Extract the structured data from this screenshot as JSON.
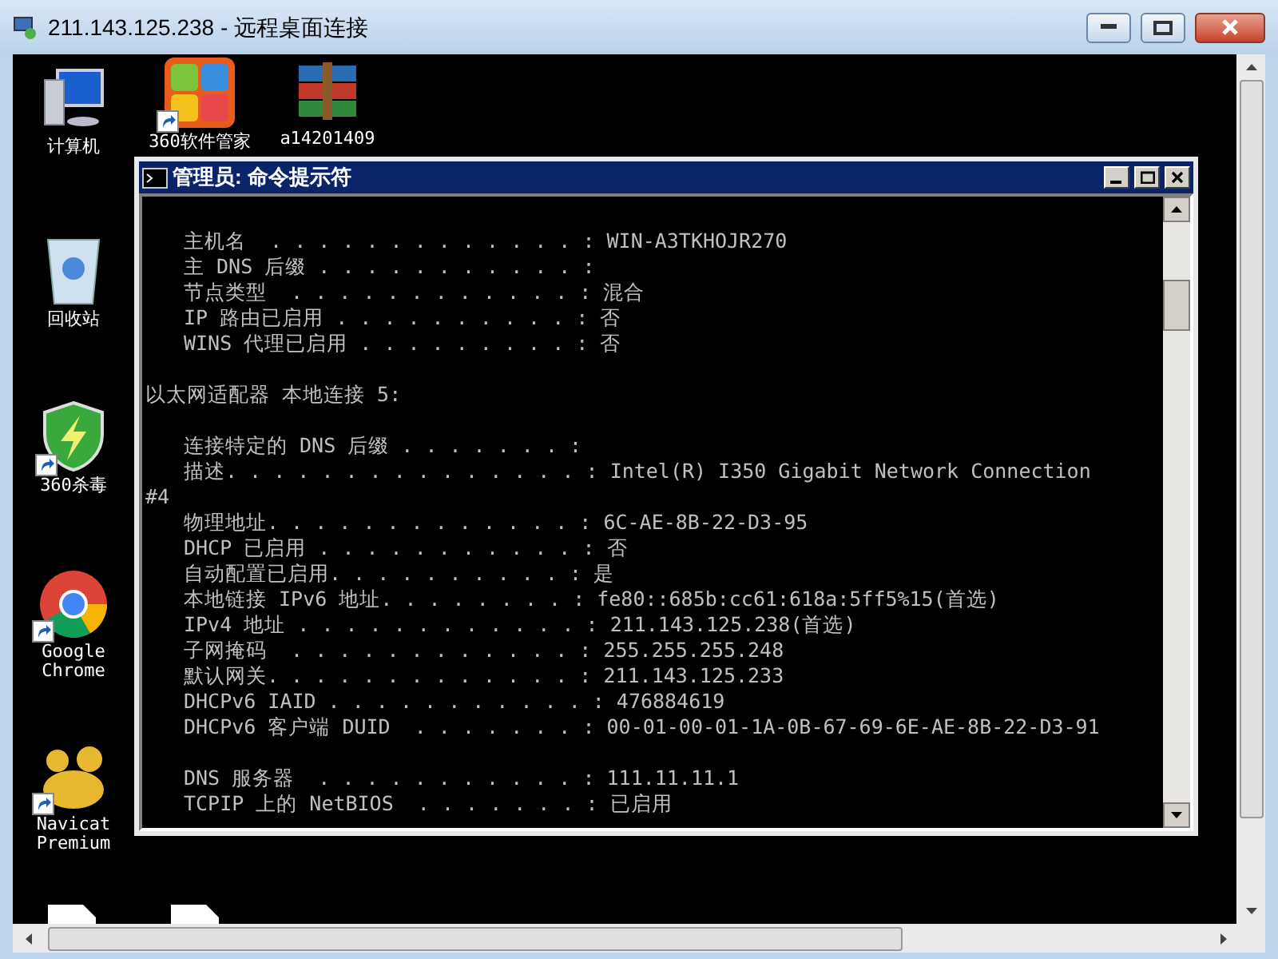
{
  "window": {
    "title": "211.143.125.238 - 远程桌面连接"
  },
  "desktop_icons": [
    {
      "kind": "computer",
      "label": "计算机",
      "shortcut": false
    },
    {
      "kind": "software-manager",
      "label": "360软件管家",
      "shortcut": true
    },
    {
      "kind": "archive",
      "label": "a14201409",
      "shortcut": false
    },
    {
      "kind": "recycle-bin",
      "label": "回收站",
      "shortcut": false
    },
    {
      "kind": "shield",
      "label": "360杀毒",
      "shortcut": true
    },
    {
      "kind": "browser",
      "label": "Google Chrome",
      "shortcut": true
    },
    {
      "kind": "database",
      "label": "Navicat Premium",
      "shortcut": true
    }
  ],
  "console": {
    "title": "管理员: 命令提示符",
    "lines": [
      {
        "kind": "entry",
        "text": "主机名  . . . . . . . . . . . . . : WIN-A3TKHOJR270"
      },
      {
        "kind": "entry",
        "text": "主 DNS 后缀 . . . . . . . . . . . :"
      },
      {
        "kind": "entry",
        "text": "节点类型  . . . . . . . . . . . . : 混合"
      },
      {
        "kind": "entry",
        "text": "IP 路由已启用 . . . . . . . . . . : 否"
      },
      {
        "kind": "entry",
        "text": "WINS 代理已启用 . . . . . . . . . : 否"
      },
      {
        "kind": "blank"
      },
      {
        "kind": "plain",
        "text": "以太网适配器 本地连接 5:"
      },
      {
        "kind": "blank"
      },
      {
        "kind": "entry",
        "text": "连接特定的 DNS 后缀 . . . . . . . :"
      },
      {
        "kind": "entry",
        "text": "描述. . . . . . . . . . . . . . . : Intel(R) I350 Gigabit Network Connection"
      },
      {
        "kind": "plain",
        "text": "#4"
      },
      {
        "kind": "entry",
        "text": "物理地址. . . . . . . . . . . . . : 6C-AE-8B-22-D3-95"
      },
      {
        "kind": "entry",
        "text": "DHCP 已启用 . . . . . . . . . . . : 否"
      },
      {
        "kind": "entry",
        "text": "自动配置已启用. . . . . . . . . . : 是"
      },
      {
        "kind": "entry",
        "text": "本地链接 IPv6 地址. . . . . . . . : fe80::685b:cc61:618a:5ff5%15(首选)"
      },
      {
        "kind": "entry",
        "text": "IPv4 地址 . . . . . . . . . . . . : 211.143.125.238(首选)"
      },
      {
        "kind": "entry",
        "text": "子网掩码  . . . . . . . . . . . . : 255.255.255.248"
      },
      {
        "kind": "entry",
        "text": "默认网关. . . . . . . . . . . . . : 211.143.125.233"
      },
      {
        "kind": "entry",
        "text": "DHCPv6 IAID . . . . . . . . . . . : 476884619"
      },
      {
        "kind": "entry",
        "text": "DHCPv6 客户端 DUID  . . . . . . . : 00-01-00-01-1A-0B-67-69-6E-AE-8B-22-D3-91"
      },
      {
        "kind": "blank"
      },
      {
        "kind": "entry",
        "text": "DNS 服务器  . . . . . . . . . . . : 111.11.11.1"
      },
      {
        "kind": "entry",
        "text": "TCPIP 上的 NetBIOS  . . . . . . . : 已启用"
      }
    ]
  }
}
